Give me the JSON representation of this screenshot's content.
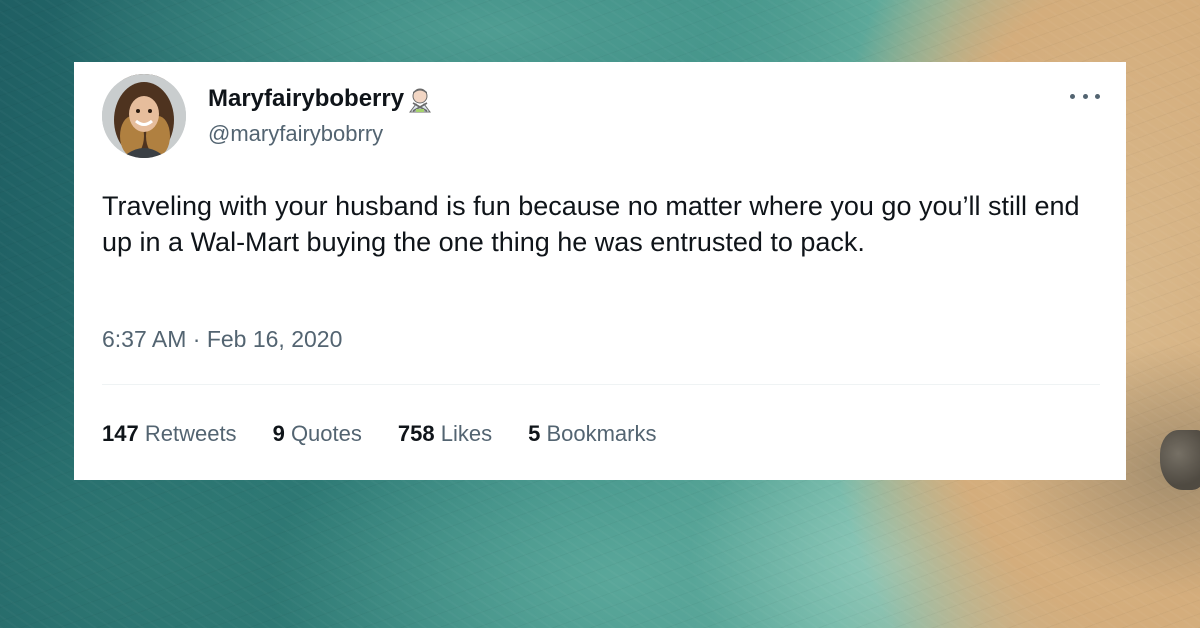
{
  "tweet": {
    "author_name": "Maryfairyboberry",
    "author_handle": "@maryfairybobrry",
    "author_emoji": "man-gesturing-no-emoji",
    "text": "Traveling with your husband is fun because no matter where you go you’ll still end up in a Wal-Mart buying the one thing he was entrusted to pack.",
    "timestamp": "6:37 AM · Feb 16, 2020",
    "more_icon": "more-dots-icon"
  },
  "stats": [
    {
      "count": "147",
      "label": "Retweets"
    },
    {
      "count": "9",
      "label": "Quotes"
    },
    {
      "count": "758",
      "label": "Likes"
    },
    {
      "count": "5",
      "label": "Bookmarks"
    }
  ],
  "colors": {
    "primary_text": "#0f1419",
    "secondary_text": "#536471",
    "card_bg": "#ffffff",
    "divider": "#eff3f4"
  }
}
